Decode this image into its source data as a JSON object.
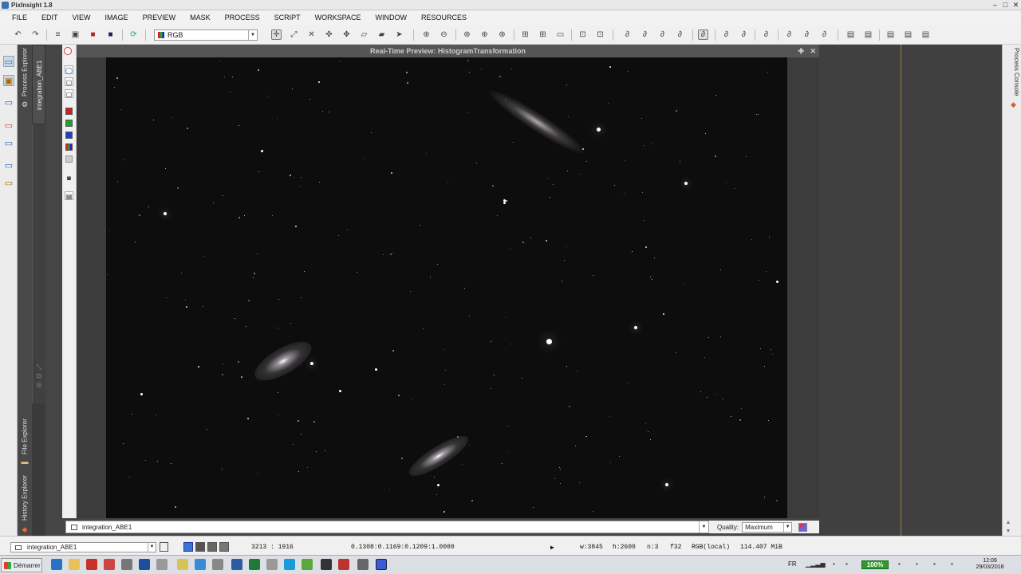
{
  "app": {
    "title": "PixInsight 1.8"
  },
  "menu": [
    "FILE",
    "EDIT",
    "VIEW",
    "IMAGE",
    "PREVIEW",
    "MASK",
    "PROCESS",
    "SCRIPT",
    "WORKSPACE",
    "WINDOW",
    "RESOURCES"
  ],
  "toolbar": {
    "channel_select": "RGB"
  },
  "left_tabs": {
    "process_explorer": "Process Explorer",
    "file_explorer": "File Explorer",
    "history_explorer": "History Explorer"
  },
  "right_tabs": {
    "process_console": "Process Console"
  },
  "image_tab": {
    "label": "integration_ABE1"
  },
  "preview": {
    "title": "Real-Time Preview: HistogramTransformation",
    "view_selector": "integration_ABE1",
    "quality_label": "Quality:",
    "quality_value": "Maximum"
  },
  "preview_channels": [
    {
      "id": "R",
      "color": "#d41f1f"
    },
    {
      "id": "G",
      "color": "#1fa31f"
    },
    {
      "id": "B",
      "color": "#1f3fd4"
    }
  ],
  "status": {
    "image_name": "integration_ABE1",
    "coords": "3213 : 1916",
    "pixel": "0.1308:0.1169:0.1209:1.0000",
    "width": "w:3845",
    "height": "h:2600",
    "channels": "n:3",
    "format": "f32",
    "colorspace": "RGB(local)",
    "size": "114.407 MiB"
  },
  "taskbar": {
    "start_label": "Démarrer",
    "lang": "FR",
    "battery": "100%",
    "time": "12:09",
    "date": "29/03/2018"
  }
}
